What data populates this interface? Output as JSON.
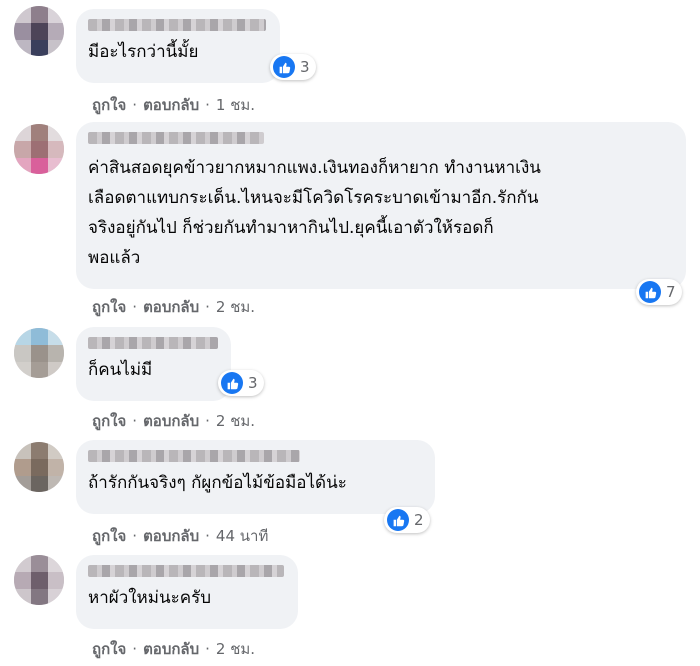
{
  "comments": [
    {
      "text": "มีอะไรกว่านี้มั้ย",
      "likes": "3",
      "like_label": "ถูกใจ",
      "reply_label": "ตอบกลับ",
      "time": "1 ชม."
    },
    {
      "text": "ค่าสินสอดยุคข้าวยากหมากแพง.เงินทองก็หายาก ทำงานหาเงิน\nเลือดตาแทบกระเด็น.ไหนจะมีโควิดโรคระบาดเข้ามาอีก.รักกัน\nจริงอยู่กันไป ก็ช่วยกันทำมาหากินไป.ยุคนี้เอาตัวให้รอดก็\nพอแล้ว",
      "likes": "7",
      "like_label": "ถูกใจ",
      "reply_label": "ตอบกลับ",
      "time": "2 ชม."
    },
    {
      "text": "ก็คนไม่มี",
      "likes": "3",
      "like_label": "ถูกใจ",
      "reply_label": "ตอบกลับ",
      "time": "2 ชม."
    },
    {
      "text": "ถ้ารักกันจริงๆ กัผูกข้อไม้ข้อมือได้น่ะ",
      "likes": "2",
      "like_label": "ถูกใจ",
      "reply_label": "ตอบกลับ",
      "time": "44 นาที"
    },
    {
      "text": "หาผัวใหม่นะครับ",
      "like_label": "ถูกใจ",
      "reply_label": "ตอบกลับ",
      "time": "2 ชม."
    }
  ],
  "colors": {
    "bubble": "#f0f2f5",
    "like_blue": "#1877f2",
    "meta_gray": "#65676b"
  },
  "icons": {
    "reaction": "thumbs-up-icon",
    "avatar": "pixelated-avatar"
  }
}
